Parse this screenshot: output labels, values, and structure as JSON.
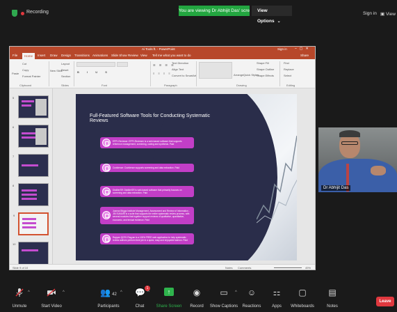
{
  "topbar": {
    "recording_label": "Recording",
    "viewing_banner": "You are viewing Dr Abhijit Das' screen",
    "view_options_label": "View Options",
    "signin_label": "Sign in",
    "view_label": "View"
  },
  "ppt": {
    "window_title": "Ai Tools ft. - PowerPoint",
    "signin_label": "Sign in",
    "tabs": [
      "File",
      "Home",
      "Insert",
      "Draw",
      "Design",
      "Transitions",
      "Animations",
      "Slide Show",
      "Review",
      "View",
      "Tell me what you want to do"
    ],
    "share_label": "Share",
    "ribbon": {
      "clipboard": "Clipboard",
      "slides": "Slides",
      "font": "Font",
      "paragraph": "Paragraph",
      "drawing": "Drawing",
      "editing": "Editing",
      "paste": "Paste",
      "cut": "Cut",
      "copy": "Copy",
      "format_painter": "Format Painter",
      "new_slide": "New Slide",
      "layout": "Layout",
      "reset": "Reset",
      "section": "Section",
      "find": "Find",
      "replace": "Replace",
      "select": "Select",
      "arrange": "Arrange",
      "quick_styles": "Quick Styles",
      "shape_fill": "Shape Fill",
      "shape_outline": "Shape Outline",
      "shape_effects": "Shape Effects",
      "text_direction": "Text Direction",
      "align_text": "Align Text",
      "convert_smartart": "Convert to SmartArt"
    },
    "thumb_numbers": [
      "5",
      "6",
      "7",
      "8",
      "9",
      "10"
    ],
    "slide": {
      "title": "Full-Featured Software Tools for Conducting Systematic Reviews",
      "tools": [
        "EPPI-Reviewer: EPPI-Reviewer is a web-based software that supports reference management, screening, coding and synthesis. Paid",
        "Covidence: Covidence supports screening and data extraction. Paid",
        "DistillerSR: DistillerSR is web-based software that primarily focuses on screening and data extraction. Paid",
        "Joanna Briggs Institute Management, Assessment and Review of Information - JBI SUMARI is a suite that supports the entire systematic review process, with several modules that together support reviews of qualitative, quantitative, economic, and textual evidence. Paid",
        "Rayyan QCRI: Rayyan is a 100% FREE web application to help systematic review authors perform their job in a quick, easy and enjoyable fashion. Paid"
      ]
    },
    "status": {
      "slide_info": "Slide 9 of 10",
      "notes": "Notes",
      "comments": "Comments",
      "zoom": "49%"
    }
  },
  "camera": {
    "participant_name": "Dr Abhijit Das"
  },
  "toolbar": {
    "unmute": "Unmute",
    "start_video": "Start Video",
    "participants": "Participants",
    "participant_count": "42",
    "chat": "Chat",
    "chat_badge": "1",
    "share_screen": "Share Screen",
    "record": "Record",
    "show_captions": "Show Captions",
    "reactions": "Reactions",
    "apps": "Apps",
    "whiteboards": "Whiteboards",
    "notes": "Notes",
    "leave": "Leave"
  },
  "colors": {
    "zoom_bg": "#1a1a1a",
    "share_green": "#2fb44d",
    "leave_red": "#e0383e",
    "ppt_orange": "#b7472a",
    "slide_navy": "#2a2d4a",
    "tool_magenta": "#c23ec7"
  },
  "icons": [
    "shield-icon",
    "mic-muted-icon",
    "video-off-icon",
    "participants-icon",
    "chat-icon",
    "share-screen-icon",
    "record-icon",
    "captions-icon",
    "reactions-icon",
    "apps-icon",
    "whiteboard-icon",
    "notes-icon"
  ]
}
